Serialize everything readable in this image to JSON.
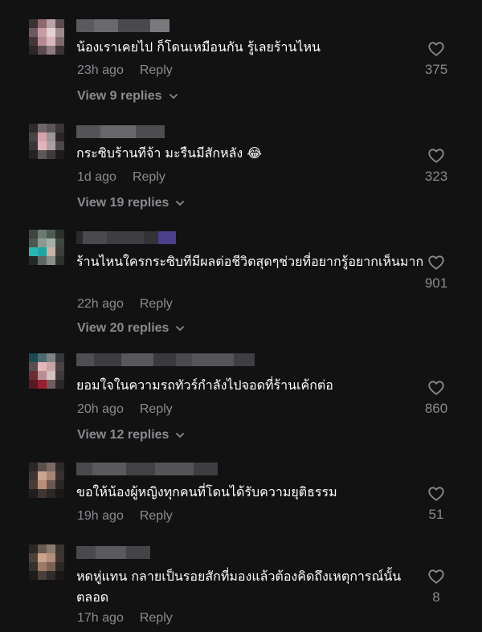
{
  "comments": [
    {
      "text": "น้องเราเคยไป ก็โดนเหมือนกัน รู้เลยร้านไหน",
      "time": "23h ago",
      "reply_label": "Reply",
      "view_replies": "View 9 replies",
      "likes": "375",
      "icon": "heart-outline-icon"
    },
    {
      "text": "กระซิบร้านทีจ้า มะรืนมีสักหลัง 😂",
      "time": "1d ago",
      "reply_label": "Reply",
      "view_replies": "View 19 replies",
      "likes": "323",
      "icon": "heart-outline-icon"
    },
    {
      "text": "ร้านไหนใครกระซิบทีมีผลต่อชีวิตสุดๆช่วยที่อยากรู้อยากเห็นมาก",
      "time": "22h ago",
      "reply_label": "Reply",
      "view_replies": "View 20 replies",
      "likes": "901",
      "icon": "heart-outline-icon"
    },
    {
      "text": "ยอมใจในความรถทัวร์กำลังไปจอดที่ร้านเค้กต่อ",
      "time": "20h ago",
      "reply_label": "Reply",
      "view_replies": "View 12 replies",
      "likes": "860",
      "icon": "heart-outline-icon"
    },
    {
      "text": "ขอให้น้องผู้หญิงทุกคนที่โดนได้รับความยุติธรรม",
      "time": "19h ago",
      "reply_label": "Reply",
      "view_replies": "",
      "likes": "51",
      "icon": "heart-outline-icon"
    },
    {
      "text": "หดหู่แทน กลายเป็นรอยสักที่มองแล้วต้องคิดถึงเหตุการณ์นั้นตลอด",
      "time": "17h ago",
      "reply_label": "Reply",
      "view_replies": "",
      "likes": "8",
      "icon": "heart-outline-icon"
    }
  ],
  "colors": {
    "background": "#121212",
    "text": "#ffffff",
    "muted": "#8a8b91"
  }
}
